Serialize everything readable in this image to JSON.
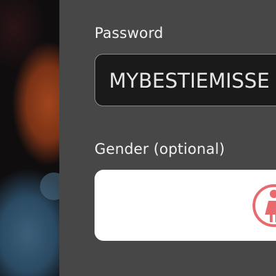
{
  "form": {
    "password_label": "Password",
    "password_value": "MYBESTIEMISSE",
    "gender_label": "Gender (optional)"
  },
  "icons": {
    "gender_female": "female-person-icon"
  },
  "colors": {
    "panel_background": "#474747",
    "input_background": "#1a1a1a",
    "gender_icon": "#e86a6f"
  }
}
